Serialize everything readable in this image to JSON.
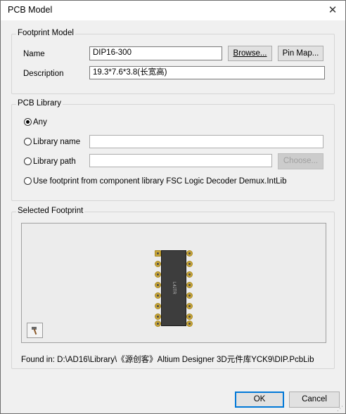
{
  "window": {
    "title": "PCB Model",
    "close_glyph": "✕"
  },
  "footprint_model": {
    "legend": "Footprint Model",
    "name_label": "Name",
    "name_value": "DIP16-300",
    "browse_label": "Browse...",
    "pinmap_label": "Pin Map...",
    "description_label": "Description",
    "description_value": "19.3*7.6*3.8(长宽高)"
  },
  "pcb_library": {
    "legend": "PCB Library",
    "options": [
      {
        "label": "Any",
        "checked": true
      },
      {
        "label": "Library name",
        "checked": false
      },
      {
        "label": "Library path",
        "checked": false
      },
      {
        "label": "Use footprint from component library FSC Logic Decoder Demux.IntLib",
        "checked": false
      }
    ],
    "library_name_value": "",
    "library_path_value": "",
    "choose_label": "Choose..."
  },
  "selected_footprint": {
    "legend": "Selected Footprint",
    "chip_label": "L4JTR",
    "found_in": "Found in: D:\\AD16\\Library\\《源创客》Altium Designer 3D元件库YCK9\\DIP.PcbLib",
    "tool_icon": "hammer-icon"
  },
  "footer": {
    "ok_label": "OK",
    "cancel_label": "Cancel"
  },
  "colors": {
    "accent": "#0078d7",
    "chip_body": "#3d3d3d",
    "pad_gold": "#c8a63a"
  }
}
